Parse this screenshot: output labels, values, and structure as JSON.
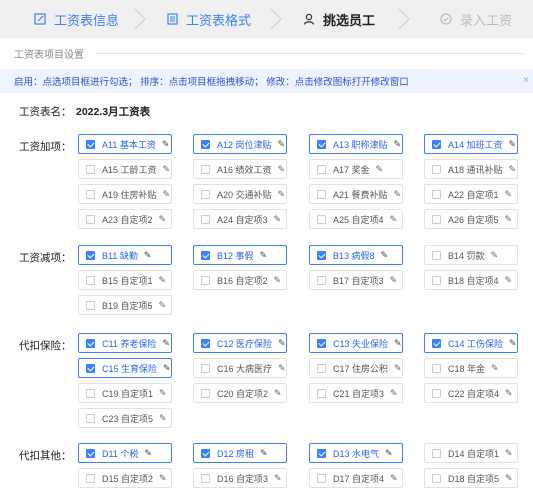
{
  "steps": [
    {
      "label": "工资表信息",
      "icon": "edit-icon",
      "state": "done"
    },
    {
      "label": "工资表格式",
      "icon": "document-icon",
      "state": "done"
    },
    {
      "label": "挑选员工",
      "icon": "user-icon",
      "state": "active"
    },
    {
      "label": "录入工资",
      "icon": "check-circle-icon",
      "state": "todo"
    }
  ],
  "section_title": "工资表项目设置",
  "info_text": "启用：点选项目框进行勾选；  排序：点击项目框拖拽移动；  修改：点击修改图标打开修改窗口",
  "table_name_label": "工资表名：",
  "table_name_value": "2022.3月工资表",
  "groups": [
    {
      "label": "工资加项：",
      "items": [
        {
          "text": "A11 基本工资",
          "checked": true
        },
        {
          "text": "A12 岗位津贴",
          "checked": true
        },
        {
          "text": "A13 职称津贴",
          "checked": true
        },
        {
          "text": "A14 加班工资",
          "checked": true
        },
        {
          "text": "A15 工龄工资",
          "checked": false
        },
        {
          "text": "A16 绩效工资",
          "checked": false
        },
        {
          "text": "A17 奖金",
          "checked": false
        },
        {
          "text": "A18 通讯补贴",
          "checked": false
        },
        {
          "text": "A19 住房补贴",
          "checked": false
        },
        {
          "text": "A20 交通补贴",
          "checked": false
        },
        {
          "text": "A21 餐费补贴",
          "checked": false
        },
        {
          "text": "A22 自定项1",
          "checked": false
        },
        {
          "text": "A23 自定项2",
          "checked": false
        },
        {
          "text": "A24 自定项3",
          "checked": false
        },
        {
          "text": "A25 自定项4",
          "checked": false
        },
        {
          "text": "A26 自定项5",
          "checked": false
        }
      ]
    },
    {
      "label": "工资减项：",
      "items": [
        {
          "text": "B11 缺勤",
          "checked": true
        },
        {
          "text": "B12 事假",
          "checked": true
        },
        {
          "text": "B13 病假8",
          "checked": true
        },
        {
          "text": "B14 罚款",
          "checked": false
        },
        {
          "text": "B15 自定项1",
          "checked": false
        },
        {
          "text": "B16 自定项2",
          "checked": false
        },
        {
          "text": "B17 自定项3",
          "checked": false
        },
        {
          "text": "B18 自定项4",
          "checked": false
        },
        {
          "text": "B19 自定项5",
          "checked": false
        }
      ]
    },
    {
      "label": "代扣保险：",
      "items": [
        {
          "text": "C11 养老保险",
          "checked": true
        },
        {
          "text": "C12 医疗保险",
          "checked": true
        },
        {
          "text": "C13 失业保险",
          "checked": true
        },
        {
          "text": "C14 工伤保险",
          "checked": true
        },
        {
          "text": "C15 生育保险",
          "checked": true
        },
        {
          "text": "C16 大病医疗",
          "checked": false
        },
        {
          "text": "C17 住房公积",
          "checked": false
        },
        {
          "text": "C18 年金",
          "checked": false
        },
        {
          "text": "C19 自定项1",
          "checked": false
        },
        {
          "text": "C20 自定项2",
          "checked": false
        },
        {
          "text": "C21 自定项3",
          "checked": false
        },
        {
          "text": "C22 自定项4",
          "checked": false
        },
        {
          "text": "C23 自定项5",
          "checked": false
        }
      ]
    },
    {
      "label": "代扣其他：",
      "items": [
        {
          "text": "D11 个税",
          "checked": true
        },
        {
          "text": "D12 房租",
          "checked": true
        },
        {
          "text": "D13 水电气",
          "checked": true
        },
        {
          "text": "D14 自定项1",
          "checked": false
        },
        {
          "text": "D15 自定项2",
          "checked": false
        },
        {
          "text": "D16 自定项3",
          "checked": false
        },
        {
          "text": "D17 自定项4",
          "checked": false
        },
        {
          "text": "D18 自定项5",
          "checked": false
        }
      ]
    }
  ],
  "colors": {
    "accent": "#3b82f6",
    "info_bg": "#eef4ff",
    "info_text": "#2d4fd8"
  }
}
